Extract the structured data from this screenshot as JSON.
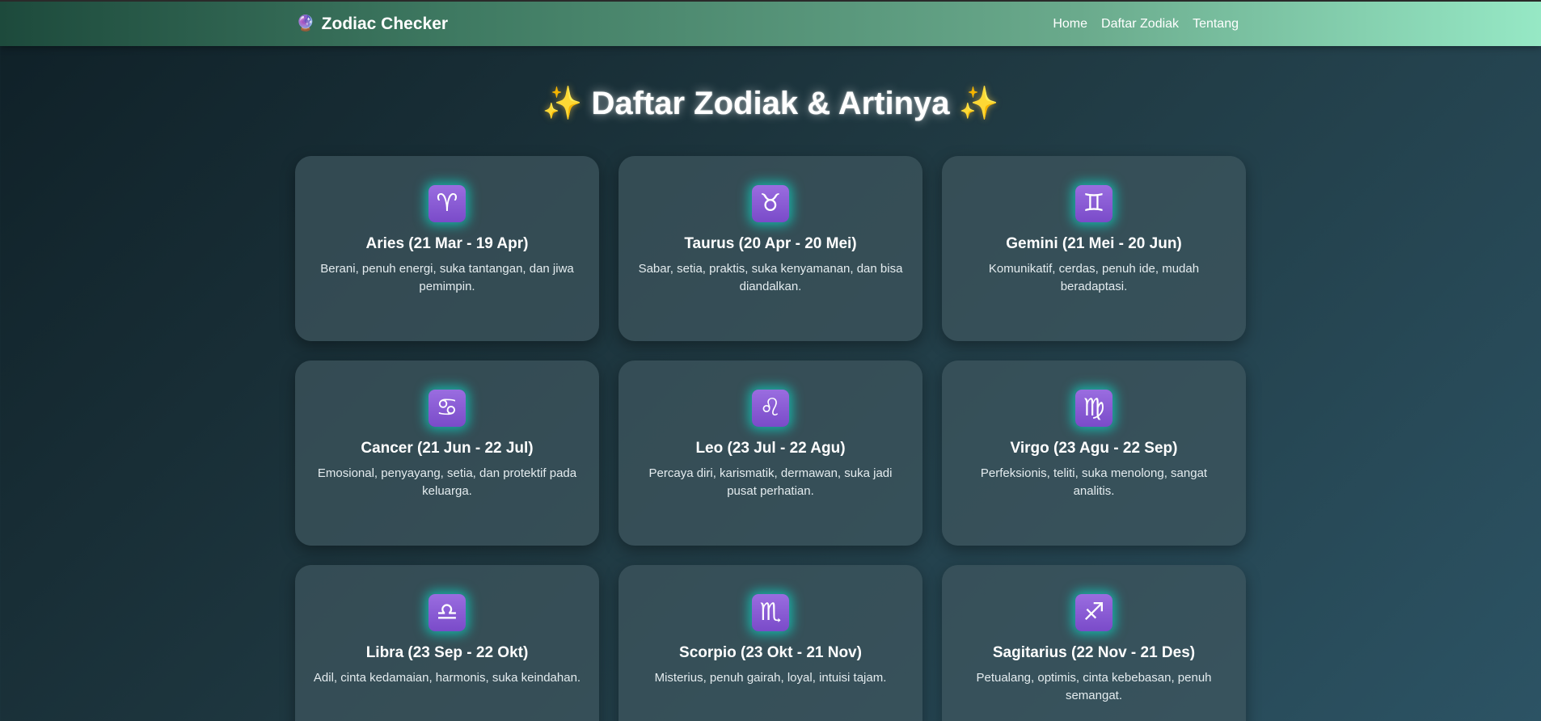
{
  "nav": {
    "brand_icon": "🔮",
    "brand": "Zodiac Checker",
    "links": [
      "Home",
      "Daftar Zodiak",
      "Tentang"
    ]
  },
  "page": {
    "sparkle_left": "✨",
    "title": "Daftar Zodiak & Artinya",
    "sparkle_right": "✨"
  },
  "zodiacs": [
    {
      "symbol": "♈",
      "icon": "aries-icon",
      "title": "Aries (21 Mar - 19 Apr)",
      "desc": "Berani, penuh energi, suka tantangan, dan jiwa pemimpin."
    },
    {
      "symbol": "♉",
      "icon": "taurus-icon",
      "title": "Taurus (20 Apr - 20 Mei)",
      "desc": "Sabar, setia, praktis, suka kenyamanan, dan bisa diandalkan."
    },
    {
      "symbol": "♊",
      "icon": "gemini-icon",
      "title": "Gemini (21 Mei - 20 Jun)",
      "desc": "Komunikatif, cerdas, penuh ide, mudah beradaptasi."
    },
    {
      "symbol": "♋",
      "icon": "cancer-icon",
      "title": "Cancer (21 Jun - 22 Jul)",
      "desc": "Emosional, penyayang, setia, dan protektif pada keluarga."
    },
    {
      "symbol": "♌",
      "icon": "leo-icon",
      "title": "Leo (23 Jul - 22 Agu)",
      "desc": "Percaya diri, karismatik, dermawan, suka jadi pusat perhatian."
    },
    {
      "symbol": "♍",
      "icon": "virgo-icon",
      "title": "Virgo (23 Agu - 22 Sep)",
      "desc": "Perfeksionis, teliti, suka menolong, sangat analitis."
    },
    {
      "symbol": "♎",
      "icon": "libra-icon",
      "title": "Libra (23 Sep - 22 Okt)",
      "desc": "Adil, cinta kedamaian, harmonis, suka keindahan."
    },
    {
      "symbol": "♏",
      "icon": "scorpio-icon",
      "title": "Scorpio (23 Okt - 21 Nov)",
      "desc": "Misterius, penuh gairah, loyal, intuisi tajam."
    },
    {
      "symbol": "♐",
      "icon": "sagittarius-icon",
      "title": "Sagitarius (22 Nov - 21 Des)",
      "desc": "Petualang, optimis, cinta kebebasan, penuh semangat."
    }
  ]
}
